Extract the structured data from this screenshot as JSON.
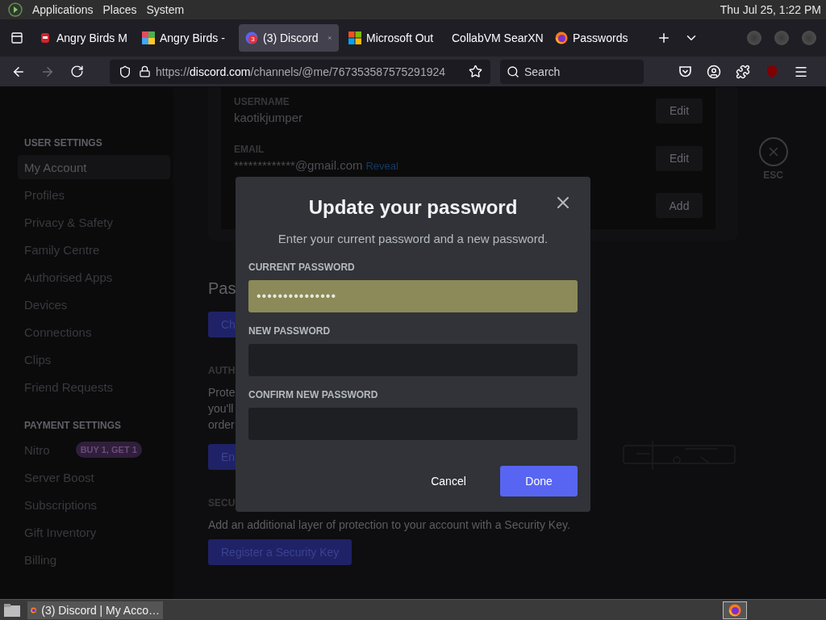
{
  "desktop_panel": {
    "menus": [
      "Applications",
      "Places",
      "System"
    ],
    "clock": "Thu Jul 25, 1:22 PM"
  },
  "browser": {
    "tabs": [
      {
        "title": "Angry Birds M",
        "kind": "bird",
        "selected": false
      },
      {
        "title": "Angry Birds -",
        "kind": "tiles",
        "selected": false
      },
      {
        "title": "(3) Discord",
        "kind": "chat",
        "badge": "3",
        "selected": true
      },
      {
        "title": "Microsoft Out",
        "kind": "squares",
        "selected": false
      },
      {
        "title": "CollabVM SearXN",
        "kind": "none",
        "selected": false
      },
      {
        "title": "Passwords",
        "kind": "fox",
        "selected": false
      }
    ],
    "url": "https://**discord.com**/channels/@me/767353587575291924",
    "search": {
      "placeholder": "Search"
    }
  },
  "settings": {
    "sidebar": [
      {
        "header": "USER SETTINGS",
        "items": [
          {
            "label": "My Account",
            "selected": true
          },
          {
            "label": "Profiles",
            "selected": false
          },
          {
            "label": "Privacy & Safety",
            "selected": false
          },
          {
            "label": "Family Centre",
            "selected": false
          },
          {
            "label": "Authorised Apps",
            "selected": false
          },
          {
            "label": "Devices",
            "selected": false
          },
          {
            "label": "Connections",
            "selected": false
          },
          {
            "label": "Clips",
            "selected": false
          },
          {
            "label": "Friend Requests",
            "selected": false
          }
        ]
      },
      {
        "header": "PAYMENT SETTINGS",
        "items": [
          {
            "label": "Nitro",
            "badge": "BUY 1, GET 1",
            "selected": false
          },
          {
            "label": "Server Boost",
            "selected": false
          },
          {
            "label": "Subscriptions",
            "selected": false
          },
          {
            "label": "Gift Inventory",
            "selected": false
          },
          {
            "label": "Billing",
            "selected": false
          }
        ]
      }
    ],
    "account_card": {
      "rows": [
        {
          "label": "USERNAME",
          "value": "kaotikjumper",
          "button": "Edit"
        },
        {
          "label": "EMAIL",
          "value": "*************@gmail.com",
          "link": "Reveal",
          "button": "Edit"
        },
        {
          "button": "Add"
        }
      ]
    },
    "password_section": {
      "heading": "Pas",
      "button": "Ch"
    },
    "authentication": {
      "heading": "AUTH",
      "lines": [
        "Prote",
        "you'll",
        "order"
      ],
      "button": "En"
    },
    "security_key": {
      "heading": "SECU",
      "text": "Add an additional layer of protection to your account with a Security Key.",
      "button": "Register a Security Key"
    },
    "close": {
      "label": "ESC"
    }
  },
  "modal": {
    "title": "Update your password",
    "subtitle": "Enter your current password and a new password.",
    "fields": [
      {
        "label": "CURRENT PASSWORD",
        "value": "•••••••••••••••",
        "autofilled": true
      },
      {
        "label": "NEW PASSWORD",
        "autofilled": false
      },
      {
        "label": "CONFIRM NEW PASSWORD",
        "autofilled": false
      }
    ],
    "buttons": [
      {
        "label": "Cancel",
        "kind": "secondary"
      },
      {
        "label": "Done",
        "kind": "primary"
      }
    ]
  },
  "taskbar": {
    "tasks": [
      {
        "title": "(3) Discord | My Acco…",
        "selected": true
      }
    ]
  }
}
